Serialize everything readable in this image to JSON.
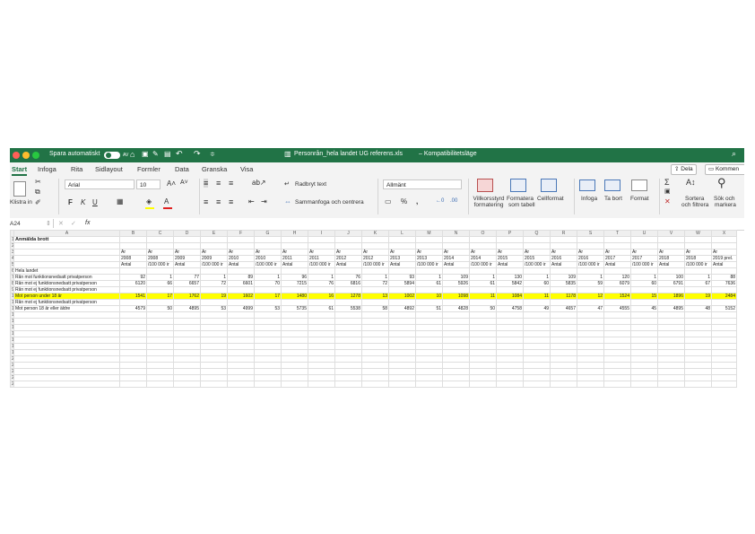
{
  "window": {
    "autosave_label": "Spara automatiskt",
    "autosave_state": "AV",
    "title": "Personrån_hela landet UG referens.xls",
    "title_suffix": "–  Kompatibilitetsläge"
  },
  "menu": {
    "tabs": [
      "Start",
      "Infoga",
      "Rita",
      "Sidlayout",
      "Formler",
      "Data",
      "Granska",
      "Visa"
    ],
    "active": "Start",
    "share": "Dela",
    "comments": "Kommen"
  },
  "ribbon": {
    "paste": "Klistra in",
    "font_name": "Arial",
    "font_size": "10",
    "bold": "F",
    "italic": "K",
    "underline": "U",
    "wrap_text": "Radbryt text",
    "merge_center": "Sammanfoga och centrera",
    "number_format": "Allmänt",
    "conditional_1": "Villkorsstyrd",
    "conditional_2": "formatering",
    "format_table_1": "Formatera",
    "format_table_2": "som tabell",
    "cell_format": "Cellformat",
    "insert": "Infoga",
    "delete": "Ta bort",
    "format": "Format",
    "sort_1": "Sortera",
    "sort_2": "och filtrera",
    "find_1": "Sök och",
    "find_2": "markera"
  },
  "formula_bar": {
    "cell_ref": "A24",
    "fx": "fx"
  },
  "sheet": {
    "columns": [
      "A",
      "B",
      "C",
      "D",
      "E",
      "F",
      "G",
      "H",
      "I",
      "J",
      "K",
      "L",
      "M",
      "N",
      "O",
      "P",
      "Q",
      "R",
      "S",
      "T",
      "U",
      "V",
      "W",
      "X"
    ],
    "row_numbers": [
      "1",
      "2",
      "3",
      "4",
      "5",
      "6",
      "7",
      "8",
      "9",
      "10",
      "11",
      "12",
      "13",
      "14",
      "15",
      "16",
      "17",
      "18",
      "19",
      "20",
      "21",
      "22",
      "23",
      "24",
      "25"
    ],
    "title": "Anmälda brott",
    "year_label": "År",
    "years": [
      "2008",
      "2008",
      "2009",
      "2009",
      "2010",
      "2010",
      "2011",
      "2011",
      "2012",
      "2012",
      "2013",
      "2013",
      "2014",
      "2014",
      "2015",
      "2015",
      "2016",
      "2016",
      "2017",
      "2017",
      "2018",
      "2018",
      "2019 prel."
    ],
    "units": [
      "Antal",
      "/100 000 ir",
      "Antal",
      "/100 000 ir",
      "Antal",
      "/100 000 ir",
      "Antal",
      "/100 000 ir",
      "Antal",
      "/100 000 ir",
      "Antal",
      "/100 000 ir",
      "Antal",
      "/100 000 ir",
      "Antal",
      "/100 000 ir",
      "Antal",
      "/100 000 ir",
      "Antal",
      "/100 000 ir",
      "Antal",
      "/100 000 ir",
      "Antal"
    ],
    "rows": [
      {
        "label": "Hela landet",
        "values": []
      },
      {
        "label": "Rån mot funktionsnedsatt privatperson",
        "values": [
          "92",
          "1",
          "77",
          "1",
          "89",
          "1",
          "96",
          "1",
          "76",
          "1",
          "93",
          "1",
          "109",
          "1",
          "130",
          "1",
          "109",
          "1",
          "120",
          "1",
          "100",
          "1",
          "88"
        ]
      },
      {
        "label": "Rån mot ej funktionsnedsatt privatperson",
        "values": [
          "6120",
          "66",
          "6657",
          "72",
          "6601",
          "70",
          "7215",
          "76",
          "6816",
          "72",
          "5894",
          "61",
          "5926",
          "61",
          "5842",
          "60",
          "5835",
          "59",
          "6079",
          "60",
          "6791",
          "67",
          "7636"
        ]
      },
      {
        "label": "Rån mot ej funktionsnedsatt privatperson",
        "values": []
      },
      {
        "label": "Mot person under 18 år",
        "values": [
          "1541",
          "17",
          "1762",
          "19",
          "1602",
          "17",
          "1480",
          "16",
          "1278",
          "13",
          "1002",
          "10",
          "1098",
          "11",
          "1084",
          "11",
          "1178",
          "12",
          "1524",
          "15",
          "1896",
          "19",
          "2484"
        ],
        "highlight": true
      },
      {
        "label": "Rån mot ej funktionsnedsatt privatperson",
        "values": []
      },
      {
        "label": "Mot person 18 år eller äldre",
        "values": [
          "4579",
          "50",
          "4895",
          "53",
          "4999",
          "53",
          "5735",
          "61",
          "5538",
          "58",
          "4892",
          "51",
          "4828",
          "50",
          "4758",
          "49",
          "4657",
          "47",
          "4555",
          "45",
          "4895",
          "48",
          "5152"
        ]
      }
    ]
  }
}
